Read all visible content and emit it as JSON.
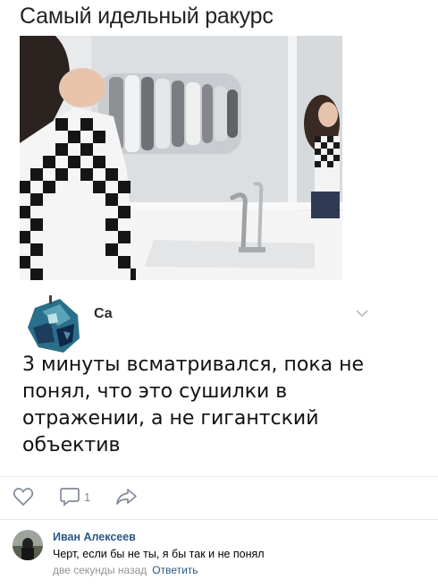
{
  "post": {
    "title": "Самый идельный ракурс",
    "photo_icon": "mirror-selfie-photo"
  },
  "inner_post": {
    "author": "Са",
    "text": "3 минуты всматривался, пока не понял, что это сушилки в отражении, а не гигантский объектив",
    "menu_icon": "chevron-down-icon"
  },
  "actions": {
    "like_icon": "heart-icon",
    "comment_icon": "comment-icon",
    "comment_count": "1",
    "share_icon": "share-arrow-icon"
  },
  "comment": {
    "author": "Иван Алексеев",
    "text": "Черт, если бы не ты, я бы так и не понял",
    "time": "две секунды назад",
    "reply_label": "Ответить"
  },
  "colors": {
    "link": "#2a5885",
    "meta": "#939393",
    "icon": "#828a99",
    "divider": "#e7e8ec"
  }
}
